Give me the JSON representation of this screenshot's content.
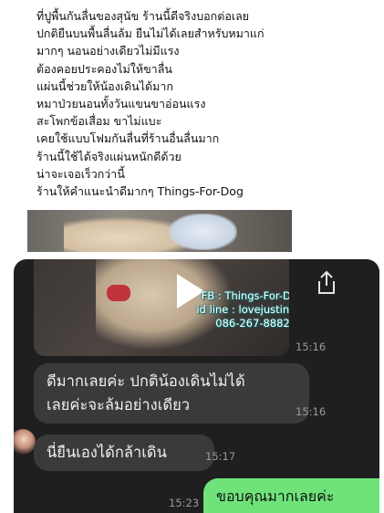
{
  "review_lines": [
    "ที่ปูพื้นกันลื่นของสุนัข ร้านนี้ดีจริงบอกต่อเลย",
    "ปกติยืนบนพื้นลื่นล้ม ยืนไม่ได้เลยสำหรับหมาแก่",
    "มากๆ นอนอย่างเดียวไม่มีแรง",
    "ต้องคอยประคองไม่ให้ขาลื่น",
    "แผ่นนี้ช่วยให้น้องเดินได้มาก",
    "หมาป่วยนอนทั้งวันแขนขาอ่อนแรง",
    "สะโพกข้อเสื่อม ขาไม่แบะ",
    "เคยใช้แบบโฟมกันลื่นที่ร้านอื่นลื่นมาก",
    "ร้านนี้ใช้ได้จริงแผ่นหนักดีด้วย",
    "น่าจะเจอเร็วกว่านี้",
    "ร้านให้คำแนะนำดีมากๆ Things-For-Dog"
  ],
  "watermark": {
    "fb": "FB : Things-For-Dog",
    "line": "id line : lovejustinboo",
    "phone": "086-267-8882"
  },
  "chat": {
    "video_time": "15:16",
    "msg1": {
      "line1": "ดีมากเลยค่ะ ปกติน้องเดินไม่ได้",
      "line2": "เลยค่ะจะล้มอย่างเดียว",
      "time": "15:16"
    },
    "msg2": {
      "text": "นี่ยืนเองได้กล้าเดิน",
      "time": "15:17"
    },
    "msg3": {
      "text": "ขอบคุณมากเลยค่ะ",
      "time": "15:23"
    }
  },
  "icons": {
    "play": "play-icon",
    "share": "share-icon"
  }
}
